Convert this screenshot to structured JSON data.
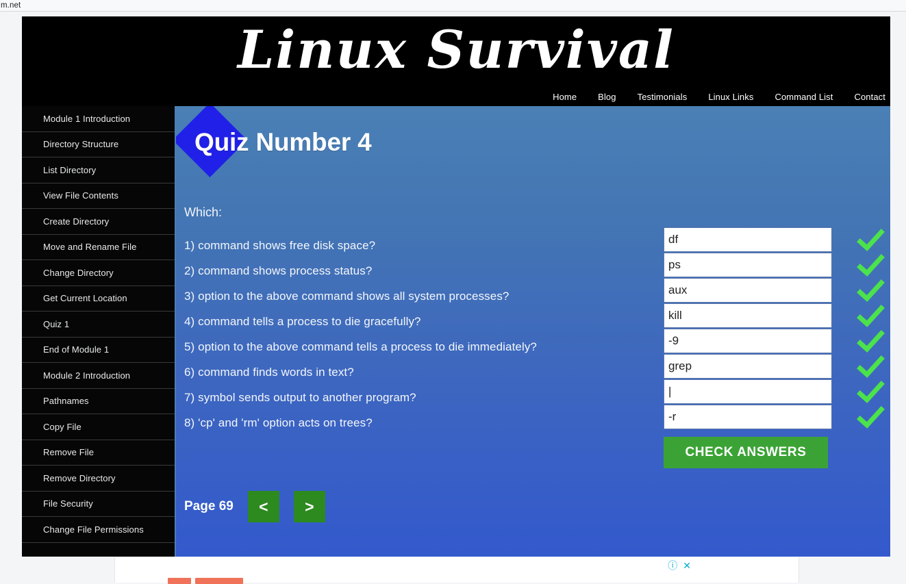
{
  "browser": {
    "url_fragment": "m.net"
  },
  "header": {
    "site_title": "Linux Survival",
    "nav": [
      {
        "label": "Home"
      },
      {
        "label": "Blog"
      },
      {
        "label": "Testimonials"
      },
      {
        "label": "Linux Links"
      },
      {
        "label": "Command List"
      },
      {
        "label": "Contact"
      }
    ]
  },
  "sidebar": {
    "items": [
      {
        "label": "Module 1 Introduction"
      },
      {
        "label": "Directory Structure"
      },
      {
        "label": "List Directory"
      },
      {
        "label": "View File Contents"
      },
      {
        "label": "Create Directory"
      },
      {
        "label": "Move and Rename File"
      },
      {
        "label": "Change Directory"
      },
      {
        "label": "Get Current Location"
      },
      {
        "label": "Quiz 1"
      },
      {
        "label": "End of Module 1"
      },
      {
        "label": "Module 2 Introduction"
      },
      {
        "label": "Pathnames"
      },
      {
        "label": "Copy File"
      },
      {
        "label": "Remove File"
      },
      {
        "label": "Remove Directory"
      },
      {
        "label": "File Security"
      },
      {
        "label": "Change File Permissions"
      }
    ]
  },
  "quiz": {
    "title": "Quiz Number 4",
    "prompt": "Which:",
    "questions": [
      {
        "text": "1) command shows free disk space?",
        "answer": "df",
        "status": "correct"
      },
      {
        "text": "2) command shows process status?",
        "answer": "ps",
        "status": "correct"
      },
      {
        "text": "3) option to the above command shows all system processes?",
        "answer": "aux",
        "status": "correct"
      },
      {
        "text": "4) command tells a process to die gracefully?",
        "answer": "kill",
        "status": "correct"
      },
      {
        "text": "5) option to the above command tells a process to die immediately?",
        "answer": "-9",
        "status": "correct"
      },
      {
        "text": "6) command finds words in text?",
        "answer": "grep",
        "status": "correct"
      },
      {
        "text": "7) symbol sends output to another program?",
        "answer": "|",
        "status": "correct"
      },
      {
        "text": "8) 'cp' and 'rm' option acts on trees?",
        "answer": "-r",
        "status": "correct"
      }
    ],
    "check_button": "CHECK ANSWERS",
    "answer_placeholder": ""
  },
  "pager": {
    "page_label": "Page 69",
    "prev_label": "<",
    "next_label": ">"
  },
  "ad": {
    "info_glyph": "ⓘ",
    "close_glyph": "✕"
  },
  "colors": {
    "accent_green": "#3ba336",
    "pager_green": "#2d8a1f",
    "diamond_blue": "#2020e8",
    "panel_top": "#4a80b5",
    "panel_bottom": "#3359cc",
    "tick_green": "#4ce24c",
    "ad_teal": "#00aecd"
  }
}
